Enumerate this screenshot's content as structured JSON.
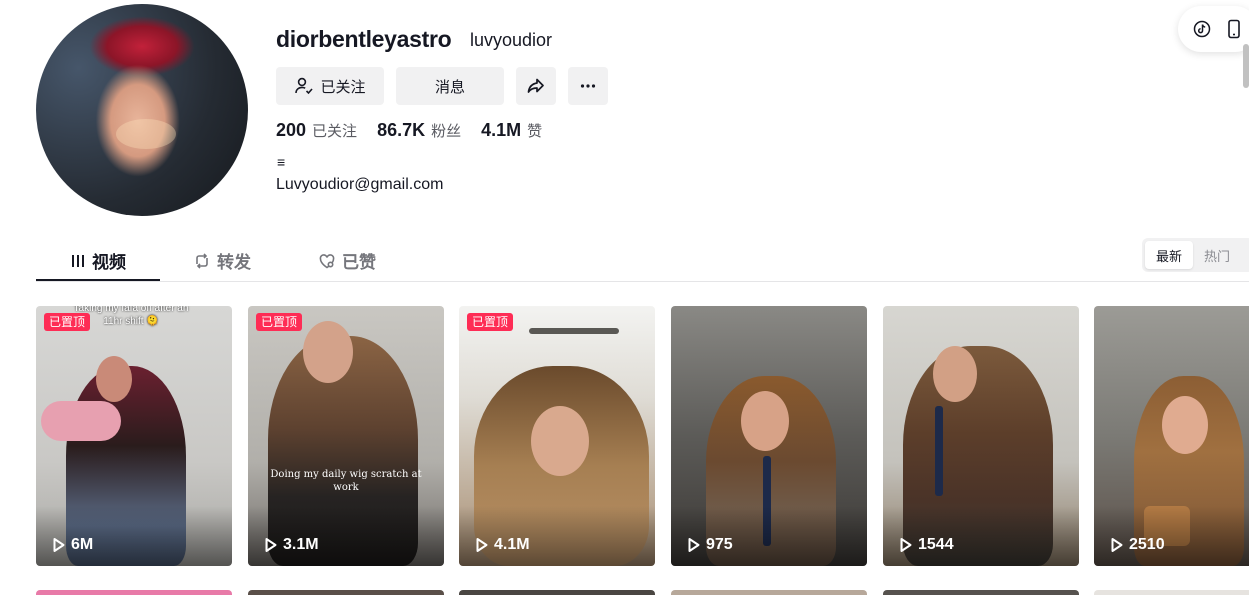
{
  "profile": {
    "username": "diorbentleyastro",
    "nickname": "luvyoudior",
    "bio_symbol": "≡",
    "bio_email": "Luvyoudior@gmail.com"
  },
  "actions": {
    "follow_label": "已关注",
    "message_label": "消息"
  },
  "stats": {
    "following_count": "200",
    "following_label": "已关注",
    "followers_count": "86.7K",
    "followers_label": "粉丝",
    "likes_count": "4.1M",
    "likes_label": "赞"
  },
  "tabs": [
    {
      "label": "视频",
      "icon": "grid-icon",
      "active": true
    },
    {
      "label": "转发",
      "icon": "repost-icon",
      "active": false
    },
    {
      "label": "已赞",
      "icon": "heart-icon",
      "active": false
    }
  ],
  "sort": {
    "latest": "最新",
    "popular": "热门"
  },
  "videos": [
    {
      "pinned_label": "已置顶",
      "plays": "6M",
      "caption": "Taking my fafa off after an 11hr shift 🫠"
    },
    {
      "pinned_label": "已置顶",
      "plays": "3.1M",
      "caption": "Doing my daily wig scratch at work"
    },
    {
      "pinned_label": "已置顶",
      "plays": "4.1M"
    },
    {
      "plays": "975"
    },
    {
      "plays": "1544"
    },
    {
      "plays": "2510"
    }
  ],
  "colors": {
    "accent": "#fe2c55",
    "text": "#161823",
    "button_bg": "#f1f1f2"
  }
}
